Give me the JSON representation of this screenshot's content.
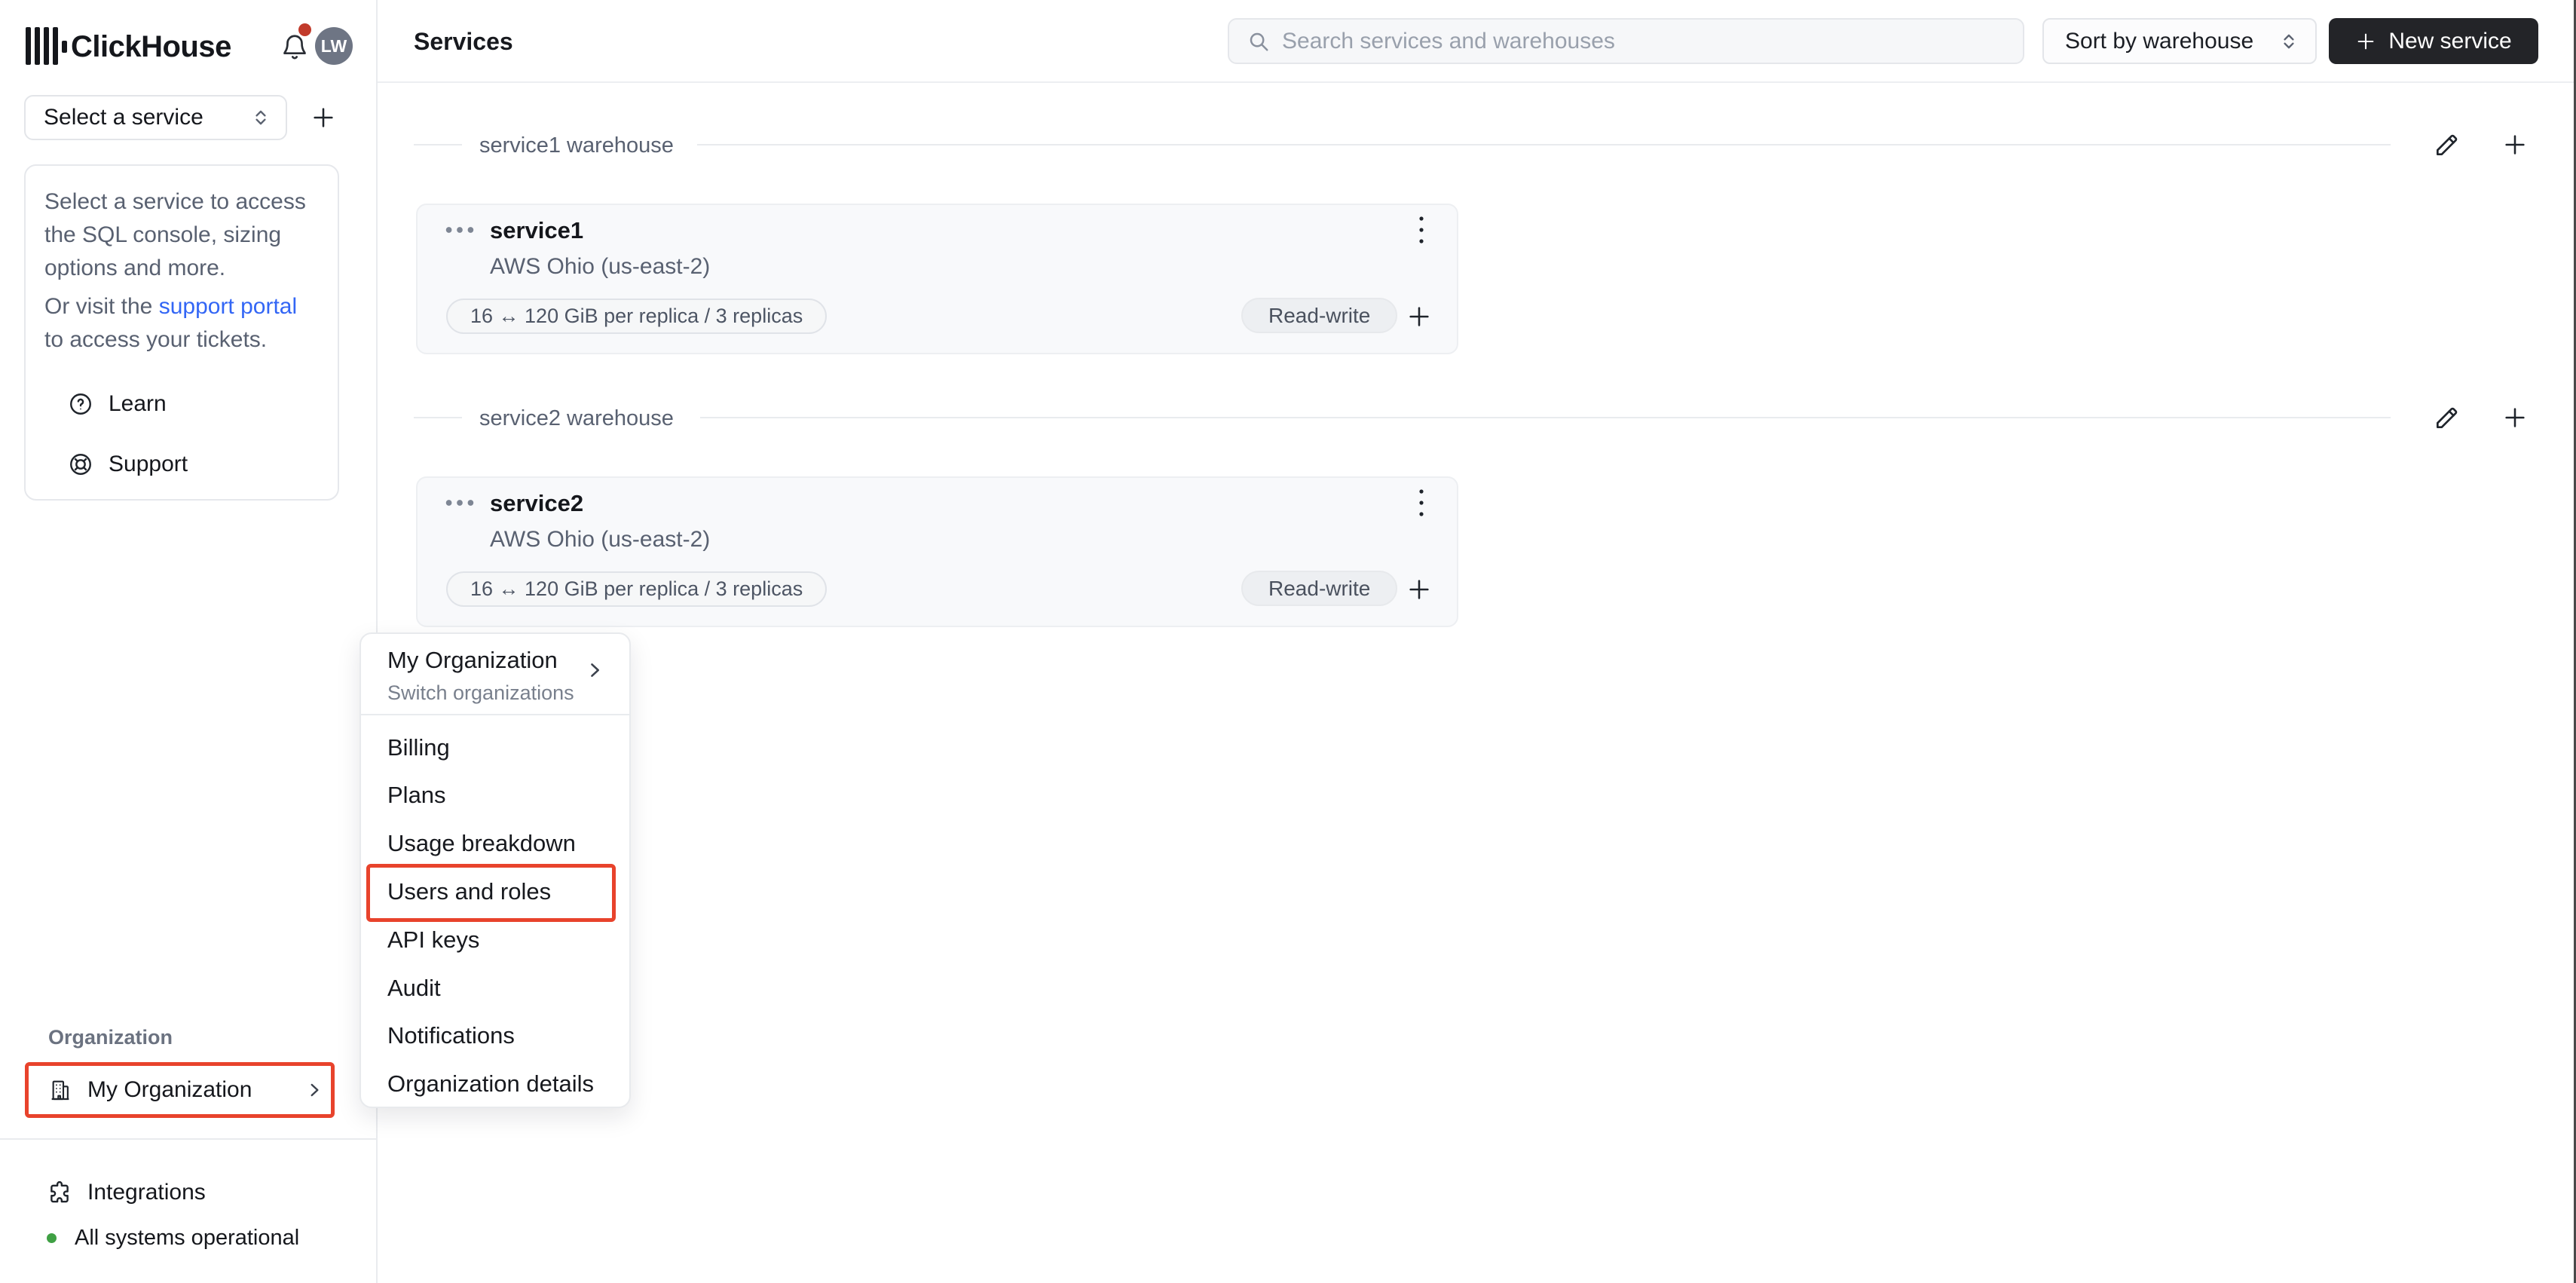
{
  "app": {
    "brand": "ClickHouse",
    "avatar_initials": "LW"
  },
  "sidebar": {
    "service_select_label": "Select a service",
    "info_card": {
      "paragraph1": "Select a service to access the SQL console, sizing options and more.",
      "paragraph2_prefix": "Or visit the ",
      "paragraph2_link": "support portal",
      "paragraph2_suffix": " to access your tickets.",
      "learn_label": "Learn",
      "support_label": "Support"
    },
    "organization_label": "Organization",
    "organization_item_label": "My Organization",
    "integrations_label": "Integrations",
    "status_label": "All systems operational"
  },
  "header": {
    "title": "Services",
    "search_placeholder": "Search services and warehouses",
    "sort_label": "Sort by warehouse",
    "new_service_label": "New service"
  },
  "warehouses": [
    {
      "label": "service1 warehouse",
      "service": {
        "name": "service1",
        "region": "AWS Ohio (us-east-2)",
        "size": "16 ↔ 120 GiB per replica / 3 replicas",
        "mode": "Read-write"
      }
    },
    {
      "label": "service2 warehouse",
      "service": {
        "name": "service2",
        "region": "AWS Ohio (us-east-2)",
        "size": "16 ↔ 120 GiB per replica / 3 replicas",
        "mode": "Read-write"
      }
    }
  ],
  "org_menu": {
    "header": {
      "title": "My Organization",
      "subtitle": "Switch organizations"
    },
    "items": [
      "Billing",
      "Plans",
      "Usage breakdown",
      "Users and roles",
      "API keys",
      "Audit",
      "Notifications",
      "Organization details"
    ],
    "highlighted_item": "Users and roles"
  },
  "colors": {
    "annotation_red": "#e8432c",
    "status_green": "#3fa044",
    "link_blue": "#3366f5",
    "notification_red": "#c13a2b",
    "new_service_button": "#232428",
    "avatar_bg": "#6e7584"
  }
}
